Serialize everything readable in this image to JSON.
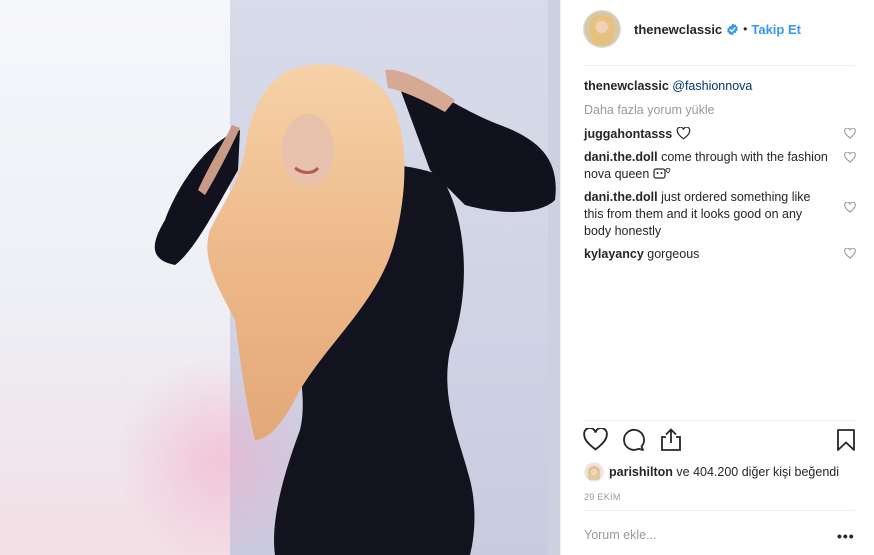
{
  "post": {
    "username": "thenewclassic",
    "separator": "•",
    "follow_label": "Takip Et",
    "verified_icon": "verified-badge-icon",
    "caption": {
      "user": "thenewclassic",
      "mention": "@fashionnova"
    },
    "load_more": "Daha fazla yorum yükle",
    "comments": [
      {
        "user": "juggahontasss",
        "text": ""
      },
      {
        "user": "dani.the.doll",
        "text": "come through with the fashion nova queen"
      },
      {
        "user": "dani.the.doll",
        "text": "just ordered something like this from them and it looks good on any body honestly"
      },
      {
        "user": "kylayancy",
        "text": "gorgeous"
      }
    ],
    "likes": {
      "user": "parishilton",
      "text": "ve 404.200 diğer kişi beğendi"
    },
    "date": "29 EKİM",
    "add_comment_placeholder": "Yorum ekle...",
    "more_label": "•••",
    "accent_color": "#3897f0"
  }
}
